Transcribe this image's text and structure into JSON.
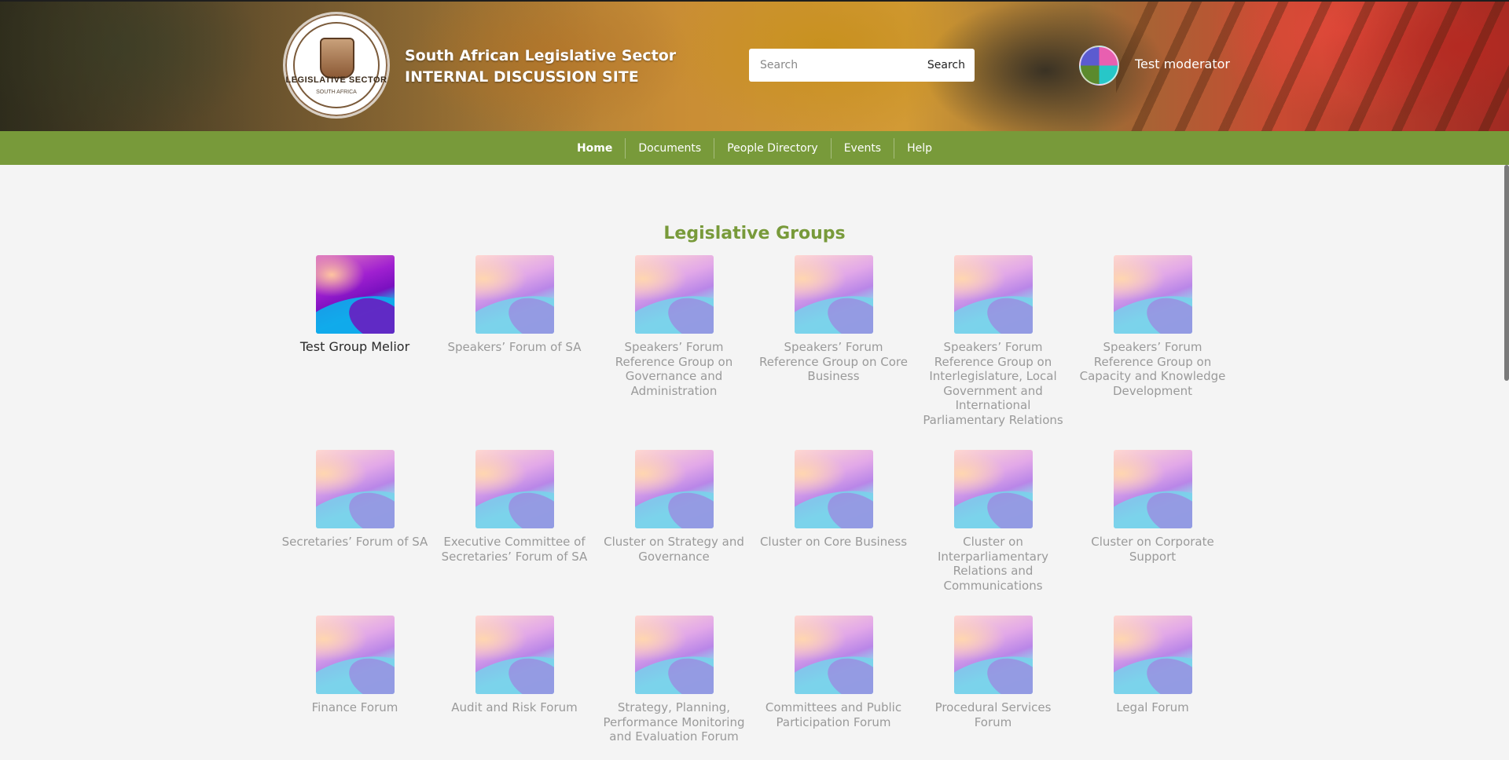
{
  "header": {
    "logo_text": "LEGISLATIVE SECTOR",
    "logo_subtext": "SOUTH AFRICA",
    "title_line1": "South African Legislative Sector",
    "title_line2": "INTERNAL DISCUSSION SITE",
    "search_placeholder": "Search",
    "search_button": "Search",
    "username": "Test moderator"
  },
  "nav": {
    "items": [
      {
        "label": "Home",
        "active": true
      },
      {
        "label": "Documents"
      },
      {
        "label": "People Directory"
      },
      {
        "label": "Events"
      },
      {
        "label": "Help"
      }
    ]
  },
  "main": {
    "section_title": "Legislative Groups",
    "groups": [
      {
        "label": "Test Group Melior",
        "active": true
      },
      {
        "label": "Speakers’ Forum of SA"
      },
      {
        "label": "Speakers’ Forum Reference Group on Governance and Administration"
      },
      {
        "label": "Speakers’ Forum Reference Group on Core Business"
      },
      {
        "label": "Speakers’ Forum Reference Group on Interlegislature, Local Government and International Parliamentary Relations"
      },
      {
        "label": "Speakers’ Forum Reference Group on Capacity and Knowledge Development"
      },
      {
        "label": "Secretaries’ Forum of SA"
      },
      {
        "label": "Executive Committee of Secretaries’ Forum of SA"
      },
      {
        "label": "Cluster on Strategy and Governance"
      },
      {
        "label": "Cluster on Core Business"
      },
      {
        "label": "Cluster on Interparliamentary Relations and Communications"
      },
      {
        "label": "Cluster on Corporate Support"
      },
      {
        "label": "Finance Forum"
      },
      {
        "label": "Audit and Risk Forum"
      },
      {
        "label": "Strategy, Planning, Performance Monitoring and Evaluation Forum"
      },
      {
        "label": "Committees and Public Participation Forum"
      },
      {
        "label": "Procedural Services Forum"
      },
      {
        "label": "Legal Forum"
      }
    ]
  },
  "colors": {
    "nav_green": "#789a3a",
    "title_green": "#789a3a"
  }
}
